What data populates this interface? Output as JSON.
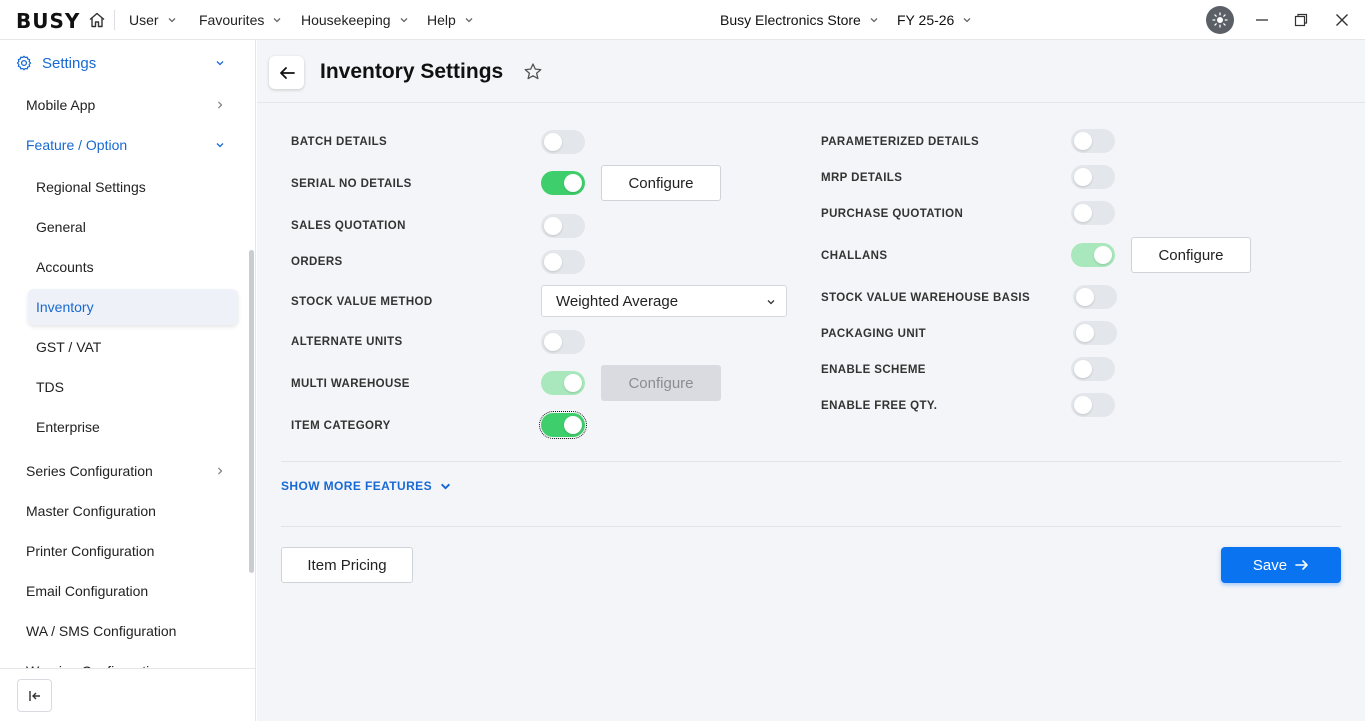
{
  "topbar": {
    "logo": "BUSY",
    "menus": [
      "User",
      "Favourites",
      "Housekeeping",
      "Help"
    ],
    "company": "Busy Electronics Store",
    "fiscal_year": "FY 25-26"
  },
  "sidebar": {
    "settings_label": "Settings",
    "items": [
      {
        "label": "Mobile App"
      },
      {
        "label": "Feature / Option"
      },
      {
        "label": "Regional Settings"
      },
      {
        "label": "General"
      },
      {
        "label": "Accounts"
      },
      {
        "label": "Inventory"
      },
      {
        "label": "GST / VAT"
      },
      {
        "label": "TDS"
      },
      {
        "label": "Enterprise"
      },
      {
        "label": "Series Configuration"
      },
      {
        "label": "Master Configuration"
      },
      {
        "label": "Printer Configuration"
      },
      {
        "label": "Email Configuration"
      },
      {
        "label": "WA / SMS Configuration"
      },
      {
        "label": "Warning Configuration"
      }
    ],
    "active_item": "Inventory"
  },
  "page": {
    "title": "Inventory Settings"
  },
  "left_options": [
    {
      "label": "BATCH DETAILS",
      "enabled": false
    },
    {
      "label": "SERIAL NO DETAILS",
      "enabled": true,
      "configure": "Configure"
    },
    {
      "label": "SALES QUOTATION",
      "enabled": false
    },
    {
      "label": "ORDERS",
      "enabled": false
    },
    {
      "label": "STOCK VALUE METHOD",
      "value": "Weighted Average"
    },
    {
      "label": "ALTERNATE UNITS",
      "enabled": false
    },
    {
      "label": "MULTI WAREHOUSE",
      "enabled": true,
      "locked": true,
      "configure": "Configure"
    },
    {
      "label": "ITEM CATEGORY",
      "enabled": true
    }
  ],
  "right_options": [
    {
      "label": "PARAMETERIZED DETAILS",
      "enabled": false
    },
    {
      "label": "MRP DETAILS",
      "enabled": false
    },
    {
      "label": "PURCHASE QUOTATION",
      "enabled": false
    },
    {
      "label": "CHALLANS",
      "enabled": true,
      "locked": true,
      "configure": "Configure"
    },
    {
      "label": "STOCK VALUE WAREHOUSE BASIS",
      "enabled": false
    },
    {
      "label": "PACKAGING UNIT",
      "enabled": false
    },
    {
      "label": "ENABLE SCHEME",
      "enabled": false
    },
    {
      "label": "ENABLE FREE QTY.",
      "enabled": false
    }
  ],
  "show_more": "SHOW MORE FEATURES",
  "buttons": {
    "item_pricing": "Item Pricing",
    "save": "Save"
  },
  "colors": {
    "accent": "#1769d3",
    "save_bg": "#0a74f0",
    "toggle_on": "#3ecf6c",
    "toggle_on_disabled": "#a9e8bc",
    "toggle_off": "#e3e6ea"
  }
}
